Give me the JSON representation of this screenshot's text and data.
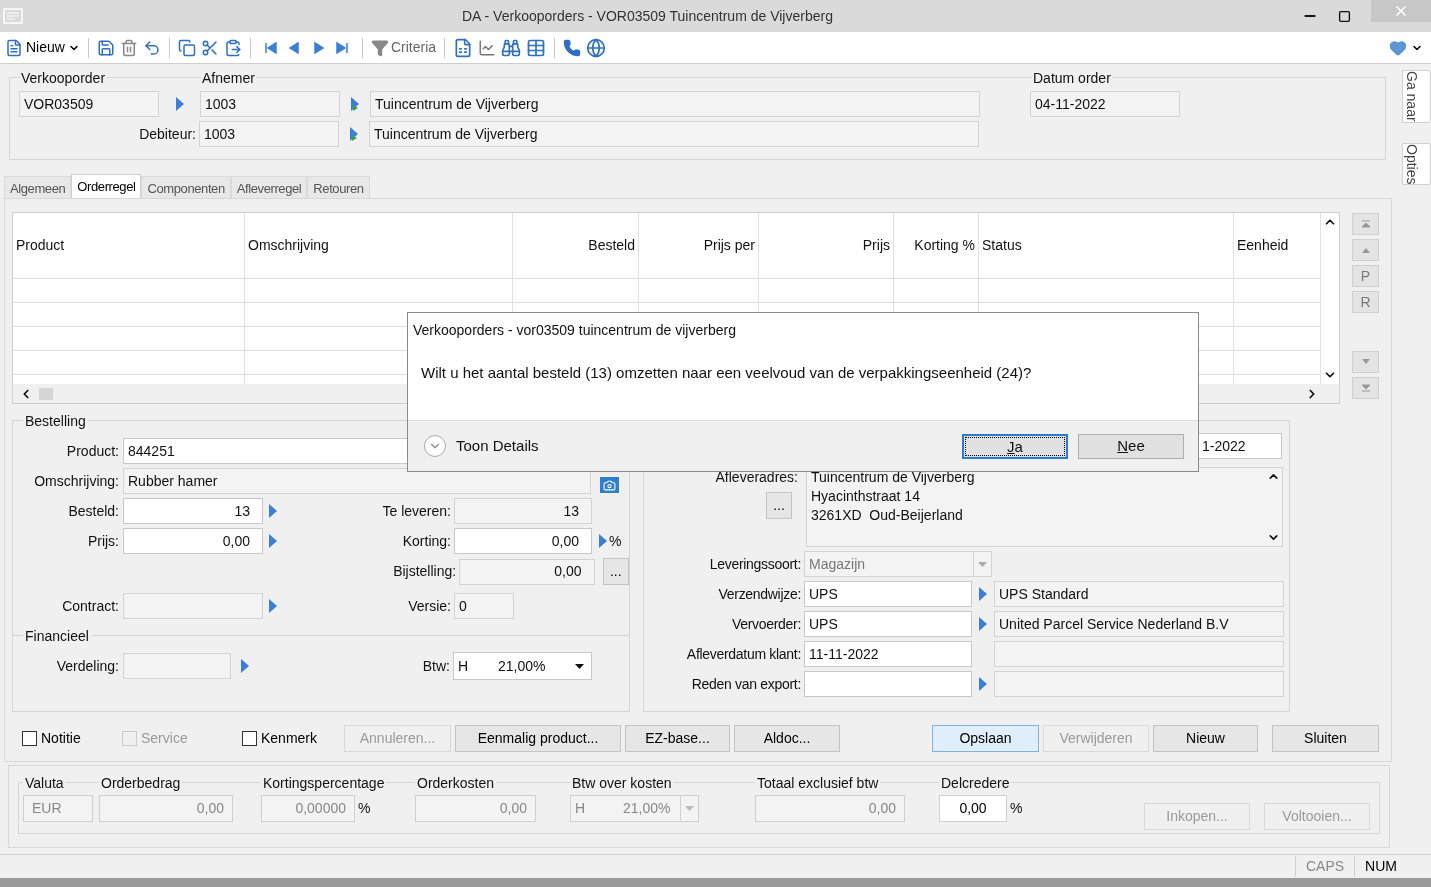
{
  "window": {
    "title": "DA - Verkooporders - VOR03509 Tuincentrum de Vijverberg"
  },
  "toolbar": {
    "new_label": "Nieuw",
    "criteria_label": "Criteria"
  },
  "side_tabs": [
    {
      "label": "Ga naar"
    },
    {
      "label": "Opties"
    }
  ],
  "header": {
    "order_legend": "Verkooporder",
    "order_number": "VOR03509",
    "customer_legend": "Afnemer",
    "customer_code": "1003",
    "customer_name": "Tuincentrum de Vijverberg",
    "debtor_label": "Debiteur:",
    "debtor_code": "1003",
    "debtor_name": "Tuincentrum de Vijverberg",
    "date_legend": "Datum order",
    "order_date": "04-11-2022"
  },
  "tabs": [
    {
      "label": "Algemeen",
      "selected": false
    },
    {
      "label": "Orderregel",
      "selected": true
    },
    {
      "label": "Componenten",
      "selected": false
    },
    {
      "label": "Afleverregel",
      "selected": false
    },
    {
      "label": "Retouren",
      "selected": false
    }
  ],
  "table": {
    "columns": [
      {
        "label": "Product"
      },
      {
        "label": "Omschrijving"
      },
      {
        "label": "Besteld"
      },
      {
        "label": "Prijs per"
      },
      {
        "label": "Prijs"
      },
      {
        "label": "Korting %"
      },
      {
        "label": "Status"
      },
      {
        "label": "Eenheid"
      }
    ],
    "side_buttons": [
      {
        "kind": "first"
      },
      {
        "kind": "up"
      },
      {
        "kind": "letter",
        "label": "P"
      },
      {
        "kind": "letter",
        "label": "R"
      },
      {
        "kind": "gap"
      },
      {
        "kind": "down"
      },
      {
        "kind": "last"
      }
    ]
  },
  "order_line": {
    "legend": "Bestelling",
    "product_label": "Product:",
    "product": "844251",
    "description_label": "Omschrijving:",
    "description": "Rubber hamer",
    "ordered_label": "Besteld:",
    "ordered": "13",
    "to_deliver_label": "Te leveren:",
    "to_deliver": "13",
    "price_label": "Prijs:",
    "price": "0,00",
    "discount_label": "Korting:",
    "discount": "0,00",
    "discount_unit": "%",
    "adjustment_label": "Bijstelling:",
    "adjustment": "0,00",
    "adjustment_button": "...",
    "contract_label": "Contract:",
    "version_label": "Versie:",
    "version": "0"
  },
  "financial": {
    "legend": "Financieel",
    "distribution_label": "Verdeling:",
    "vat_label": "Btw:",
    "vat_code": "H",
    "vat_rate": "21,00%"
  },
  "delivery": {
    "date_partial": "1-2022",
    "address_label": "Afleveradres:",
    "address_button": "...",
    "address_lines": [
      "Tuincentrum de Vijverberg",
      "Hyacinthstraat 14",
      "3261XD  Oud-Beijerland"
    ],
    "fields": [
      {
        "label": "Leveringssoort:",
        "kind": "select",
        "value": "Magazijn"
      },
      {
        "label": "Verzendwijze:",
        "kind": "lookup",
        "value": "UPS",
        "description": "UPS Standard"
      },
      {
        "label": "Vervoerder:",
        "kind": "lookup",
        "value": "UPS",
        "description": "United Parcel Service Nederland B.V"
      },
      {
        "label": "Afleverdatum klant:",
        "kind": "date",
        "value": "11-11-2022"
      },
      {
        "label": "Reden van export:",
        "kind": "lookup"
      }
    ]
  },
  "options": [
    {
      "label": "Notitie",
      "checked": false,
      "disabled": false
    },
    {
      "label": "Service",
      "checked": false,
      "disabled": true
    },
    {
      "label": "Kenmerk",
      "checked": false,
      "disabled": false
    }
  ],
  "actions": [
    {
      "label": "Annuleren...",
      "disabled": true
    },
    {
      "label": "Eenmalig product...",
      "disabled": false
    },
    {
      "label": "EZ-base...",
      "disabled": false
    },
    {
      "label": "Aldoc...",
      "disabled": false
    }
  ],
  "main_buttons": [
    {
      "label": "Opslaan",
      "default": true,
      "disabled": false
    },
    {
      "label": "Verwijderen",
      "default": false,
      "disabled": true
    },
    {
      "label": "Nieuw",
      "default": false,
      "disabled": false
    },
    {
      "label": "Sluiten",
      "default": false,
      "disabled": false
    }
  ],
  "totals": {
    "fields": [
      {
        "legend": "Valuta",
        "kind": "text",
        "value": "EUR"
      },
      {
        "legend": "Orderbedrag",
        "kind": "number",
        "value": "0,00"
      },
      {
        "legend": "Kortingspercentage",
        "kind": "number",
        "value": "0,00000",
        "unit": "%"
      },
      {
        "legend": "Orderkosten",
        "kind": "number",
        "value": "0,00"
      },
      {
        "legend": "Btw over kosten",
        "kind": "select",
        "code": "H",
        "value": "21,00%"
      },
      {
        "legend": "Totaal exclusief btw",
        "kind": "number",
        "value": "0,00"
      },
      {
        "legend": "Delcredere",
        "kind": "editable",
        "value": "0,00",
        "unit": "%"
      }
    ],
    "buttons": [
      {
        "label": "Inkopen...",
        "disabled": true
      },
      {
        "label": "Voltooien...",
        "disabled": true
      }
    ]
  },
  "status_bar": [
    {
      "label": "CAPS",
      "active": false
    },
    {
      "label": "NUM",
      "active": true
    }
  ],
  "dialog": {
    "title": "Verkooporders - vor03509 tuincentrum de vijverberg",
    "message": "Wilt u het aantal besteld (13) omzetten naar een veelvoud van de verpakkingseenheid (24)?",
    "details_label": "Toon Details",
    "buttons": [
      {
        "label": "Ja",
        "default": true
      },
      {
        "label": "Nee",
        "default": false
      }
    ]
  }
}
